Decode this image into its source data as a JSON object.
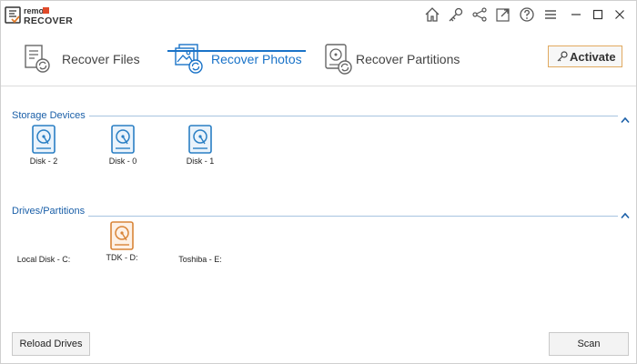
{
  "app": {
    "logo_top": "remo",
    "logo_bottom": "RECOVER"
  },
  "titlebar": {
    "icons": [
      "home-icon",
      "key-icon",
      "share-icon",
      "external-link-icon",
      "help-icon",
      "menu-icon",
      "minimize-icon",
      "maximize-icon",
      "close-icon"
    ]
  },
  "tabs": [
    {
      "label": "Recover Files",
      "icon": "recover-files-icon"
    },
    {
      "label": "Recover Photos",
      "icon": "recover-photos-icon"
    },
    {
      "label": "Recover Partitions",
      "icon": "recover-partitions-icon"
    }
  ],
  "activate": {
    "label": "Activate"
  },
  "storage": {
    "title": "Storage Devices",
    "devices": [
      {
        "label": "Disk - 2"
      },
      {
        "label": "Disk - 0"
      },
      {
        "label": "Disk - 1"
      }
    ]
  },
  "drives": {
    "title": "Drives/Partitions",
    "items": [
      {
        "label": "Local Disk - C:"
      },
      {
        "label": "TDK - D:"
      },
      {
        "label": "Toshiba - E:"
      }
    ]
  },
  "footer": {
    "reload_label": "Reload Drives",
    "scan_label": "Scan"
  },
  "colors": {
    "accent": "#1a73c8",
    "disk_blue": "#2a7fc4",
    "disk_orange": "#d98538",
    "activate_border": "#e1a95f"
  }
}
